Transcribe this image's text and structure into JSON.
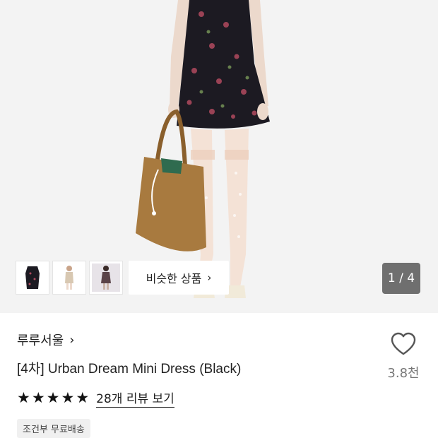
{
  "gallery": {
    "thumbnails": [
      {
        "name": "thumbnail-1",
        "icon": "dress-flat-photo"
      },
      {
        "name": "thumbnail-2",
        "icon": "model-beige-photo"
      },
      {
        "name": "thumbnail-3",
        "icon": "model-dark-photo"
      }
    ],
    "similar_products_label": "비슷한 상품",
    "similar_products_chevron": "›",
    "counter": "1 / 4",
    "current_image": 1,
    "total_images": 4
  },
  "product": {
    "brand": "루루서울",
    "brand_chevron": "›",
    "title": "[4차] Urban Dream Mini Dress (Black)",
    "like_count": "3.8천",
    "rating_stars": 5,
    "star_glyph": "★",
    "reviews_label": "28개 리뷰 보기",
    "shipping_badge": "조건부 무료배송"
  },
  "colors": {
    "dress": "#1c1a22",
    "bag": "#a87a3f",
    "skin": "#ecd9cc",
    "stocking": "#f4e2d6",
    "counter_bg": "#6f6f6f"
  }
}
